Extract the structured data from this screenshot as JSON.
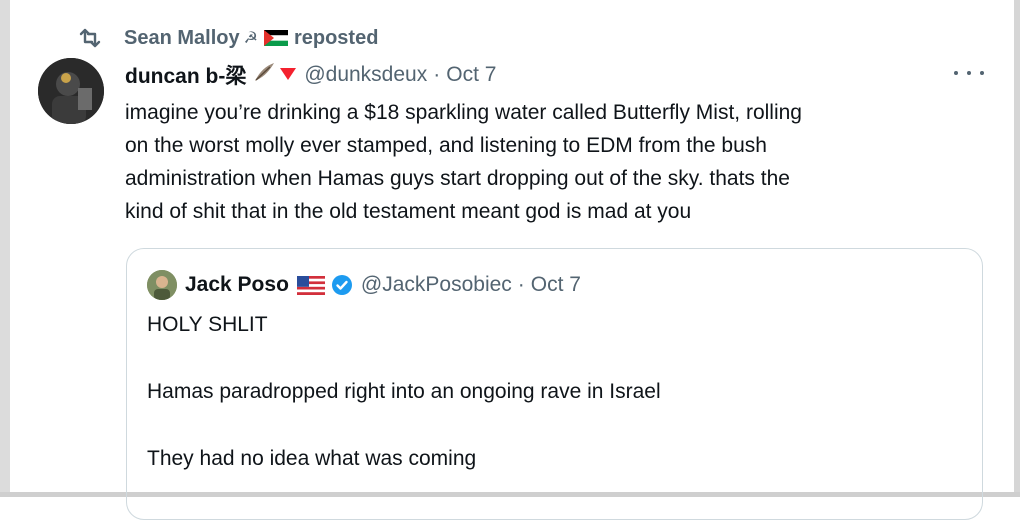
{
  "repost": {
    "icon": "repost-icon",
    "user_name": "Sean Malloy",
    "label": "reposted",
    "icons": [
      "hammer-sickle-icon",
      "palestine-flag-icon"
    ]
  },
  "tweet": {
    "display_name": "duncan b-梁",
    "name_icons": [
      "feather-icon",
      "red-triangle-icon"
    ],
    "handle": "@dunksdeux",
    "separator": "·",
    "date": "Oct 7",
    "more_icon": "more-icon",
    "text_lines": [
      "imagine you’re drinking a $18 sparkling water called Butterfly Mist, rolling",
      "on the worst molly ever stamped, and listening to EDM from the bush",
      "administration when Hamas guys start dropping out of the sky. thats the",
      "kind of shit that in the old testament meant god is mad at you"
    ]
  },
  "quote": {
    "display_name": "Jack Poso",
    "name_icons": [
      "us-flag-icon",
      "verified-badge-icon"
    ],
    "handle": "@JackPosobiec",
    "separator": "·",
    "date": "Oct 7",
    "lines": [
      "HOLY SHLIT",
      "Hamas paradropped right into an ongoing rave in Israel",
      "They had no idea what was coming"
    ]
  },
  "colors": {
    "text": "#0f1419",
    "secondary": "#536471",
    "border": "#cfd9de",
    "verified": "#1d9bf0",
    "triangle": "#f4212e"
  }
}
